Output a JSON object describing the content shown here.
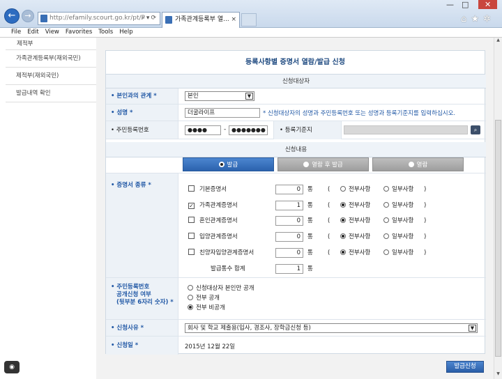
{
  "browser": {
    "url": "http://efamily.scourt.go.kr/pt/P",
    "tab_title": "가족관계등록부 열...",
    "tab_close": "×",
    "window_controls": [
      "—",
      "□",
      "✕"
    ],
    "right_icons": [
      "⌂",
      "★",
      "✲"
    ]
  },
  "menu": [
    "File",
    "Edit",
    "View",
    "Favorites",
    "Tools",
    "Help"
  ],
  "sidebar": {
    "items": [
      {
        "label": "제적부"
      },
      {
        "label": "가족관계등록부(재외국민)"
      },
      {
        "label": "제적부(재외국민)"
      },
      {
        "label": "발급내역 확인"
      }
    ]
  },
  "form": {
    "title": "등록사항별 증명서 열람/발급 신청",
    "section_applicant": "신청대상자",
    "relation_label": "• 본인과의 관계 *",
    "relation_value": "본인",
    "name_label": "• 성명 *",
    "name_value": "더굴라이프",
    "name_note": "* 신청대상자의 성명과 주민등록번호 또는 성명과 등록기준지를 입력하십시오.",
    "rrn_label": "• 주민등록번호",
    "rrn_front": "●●●●",
    "rrn_dash": "-",
    "rrn_back": "●●●●●●●",
    "base_label": "• 등록기준지",
    "search_icon": "search-icon",
    "section_content": "신청내용",
    "toggles": [
      {
        "label": "발급",
        "selected": true
      },
      {
        "label": "열람 후 발급",
        "selected": false
      },
      {
        "label": "열람",
        "selected": false
      }
    ],
    "cert_label": "• 증명서 종류 *",
    "certs": [
      {
        "name": "기본증명서",
        "checked": false,
        "count": "0",
        "unit": "통",
        "open": "(",
        "opt1": "전부사항",
        "opt2": "일부사항",
        "close": ")",
        "opt1_on": false
      },
      {
        "name": "가족관계증명서",
        "checked": true,
        "count": "1",
        "unit": "통",
        "open": "(",
        "opt1": "전부사항",
        "opt2": "일부사항",
        "close": ")",
        "opt1_on": true
      },
      {
        "name": "혼인관계증명서",
        "checked": false,
        "count": "0",
        "unit": "통",
        "open": "(",
        "opt1": "전부사항",
        "opt2": "일부사항",
        "close": ")",
        "opt1_on": true
      },
      {
        "name": "입양관계증명서",
        "checked": false,
        "count": "0",
        "unit": "통",
        "open": "(",
        "opt1": "전부사항",
        "opt2": "일부사항",
        "close": ")",
        "opt1_on": true
      },
      {
        "name": "친양자입양관계증명서",
        "checked": false,
        "count": "0",
        "unit": "통",
        "open": "(",
        "opt1": "전부사항",
        "opt2": "일부사항",
        "close": ")",
        "opt1_on": true
      }
    ],
    "total_label": "발급통수 합계",
    "total_value": "1",
    "total_unit": "통",
    "disclosure_label_1": "• 주민등록번호",
    "disclosure_label_2": "공개신청 여부",
    "disclosure_label_3": "(뒷부분 6자리 숫자) *",
    "disclosure_options": [
      {
        "label": "신청대상자 본인만 공개",
        "selected": false
      },
      {
        "label": "전부 공개",
        "selected": false
      },
      {
        "label": "전부 비공개",
        "selected": true
      }
    ],
    "reason_label": "• 신청사유 *",
    "reason_value": "회사 및 학교 제출용(입사, 경조사, 장학금신청 등)",
    "date_label": "• 신청일 *",
    "date_value": "2015년 12월 22일",
    "issue_button": "발급신청"
  }
}
